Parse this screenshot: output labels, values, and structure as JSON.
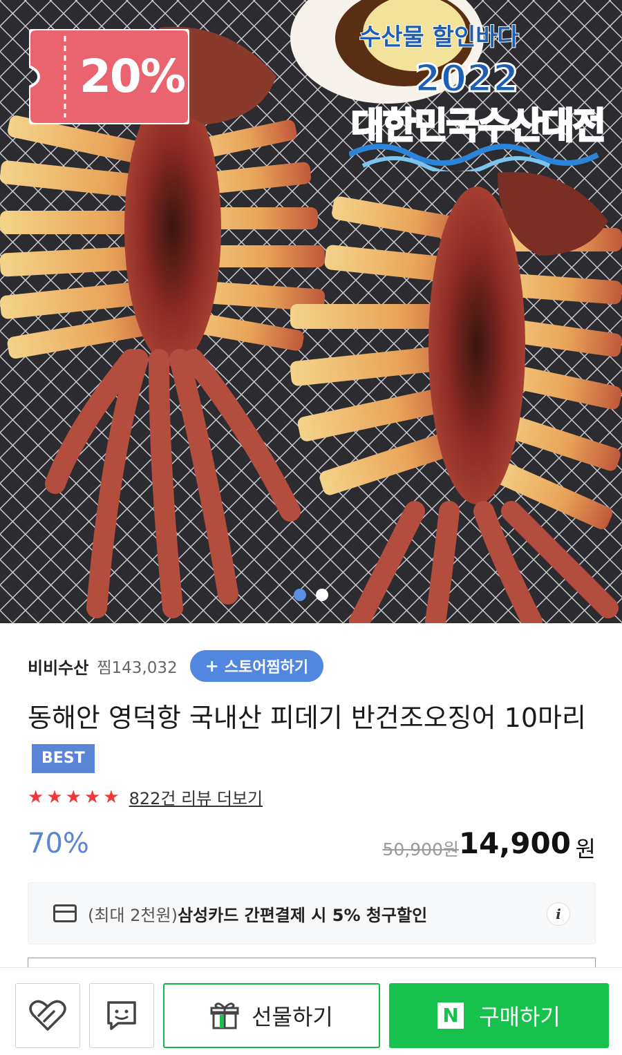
{
  "hero": {
    "coupon_text": "20%",
    "event_title_top": "수산물 할인바다",
    "event_year": "2022",
    "event_title_main": "대한민국수산대전",
    "carousel_count": 2,
    "carousel_active": 1
  },
  "store": {
    "name": "비비수산",
    "favorites": "찜143,032",
    "follow_label": "스토어찜하기"
  },
  "product": {
    "title": "동해안 영덕항 국내산 피데기 반건조오징어 10마리",
    "badge": "BEST",
    "rating_stars": 5,
    "review_link": "822건 리뷰 더보기",
    "discount_rate": "70%",
    "original_price": "50,900원",
    "sale_price": "14,900",
    "currency": "원"
  },
  "benefit": {
    "prefix": "(최대 2천원)",
    "text": "삼성카드 간편결제 시 5% 청구할인",
    "info_icon": "i"
  },
  "bottom_bar": {
    "like_icon": "heart-icon",
    "talk_icon": "talk-icon",
    "gift_label": "선물하기",
    "buy_label": "구매하기",
    "naver_logo": "N"
  },
  "colors": {
    "accent_blue": "#5287e0",
    "buy_green": "#16c24d",
    "star_red": "#f03a3a"
  }
}
